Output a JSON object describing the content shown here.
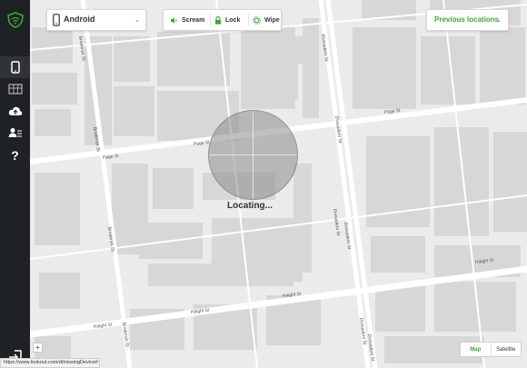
{
  "device_selector": {
    "device_name": "Android"
  },
  "actions": {
    "scream": "Scream",
    "lock": "Lock",
    "wipe": "Wipe"
  },
  "previous_locations": {
    "label": "Previous locations"
  },
  "status": {
    "locating": "Locating..."
  },
  "map_controls": {
    "zoom_in": "+",
    "map": "Map",
    "satellite": "Satellite"
  },
  "status_bar": {
    "url": "https://www.lookout.com/d/missingDevice#"
  },
  "streets": {
    "page_st_left": "Page St",
    "page_st_center": "Page St",
    "page_st_right": "Page St",
    "haight_st_left": "Haight St",
    "haight_st_mid": "Haight St",
    "haight_st_center": "Haight St",
    "haight_st_right": "Haight St",
    "broderick_top": "Broderick St",
    "broderick_mid": "Broderick St",
    "broderick_low": "Broderick St",
    "broderick_bottom": "Broderick St",
    "divisadero_top": "Divisadero St",
    "divisadero_upper": "Divisadero St",
    "divisadero_mid": "Divisadero St",
    "divisadero_low": "Divisadero St",
    "divisadero_bottom": "Divisadero St",
    "divisadero_right": "Divisadero St"
  },
  "colors": {
    "accent_green": "#3aaa35",
    "sidebar": "#1f2224",
    "map_bg": "#ebebeb",
    "block": "#d7d7d7"
  },
  "icons": {
    "logo": "lookout-shield-icon",
    "phone": "phone-icon",
    "map": "map-icon",
    "backup": "cloud-upload-icon",
    "contacts": "person-list-icon",
    "help": "question-icon",
    "exit": "sign-out-icon"
  }
}
